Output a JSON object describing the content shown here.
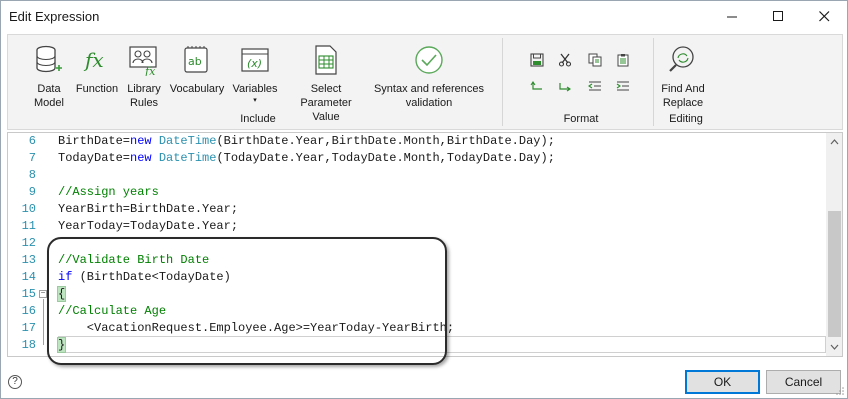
{
  "window": {
    "title": "Edit Expression"
  },
  "ribbon": {
    "include_items": [
      {
        "label": "Data\nModel",
        "icon": "database-icon"
      },
      {
        "label": "Function",
        "icon": "function-fx-icon"
      },
      {
        "label": "Library\nRules",
        "icon": "library-rules-icon"
      },
      {
        "label": "Vocabulary",
        "icon": "vocabulary-ab-icon"
      },
      {
        "label": "Variables",
        "icon": "variables-x-icon",
        "arrow": "▾"
      },
      {
        "label": "Select Parameter\nValue",
        "icon": "parameter-table-icon"
      },
      {
        "label": "Syntax and references\nvalidation",
        "icon": "validation-check-icon"
      }
    ],
    "include_group_label": "Include",
    "format_group_label": "Format",
    "format_buttons": [
      "save-icon",
      "cut-icon",
      "copy-icon",
      "paste-icon",
      "undo-icon",
      "redo-icon",
      "outdent-icon",
      "indent-icon"
    ],
    "editing_item": {
      "label": "Find And\nReplace",
      "icon": "find-replace-icon"
    },
    "editing_group_label": "Editing"
  },
  "editor": {
    "lines": [
      {
        "num": "6",
        "tokens": [
          [
            "",
            "BirthDate="
          ],
          [
            "kw",
            "new"
          ],
          [
            "",
            " "
          ],
          [
            "ty",
            "DateTime"
          ],
          [
            "",
            "(BirthDate.Year,BirthDate.Month,BirthDate.Day);"
          ]
        ]
      },
      {
        "num": "7",
        "tokens": [
          [
            "",
            "TodayDate="
          ],
          [
            "kw",
            "new"
          ],
          [
            "",
            " "
          ],
          [
            "ty",
            "DateTime"
          ],
          [
            "",
            "(TodayDate.Year,TodayDate.Month,TodayDate.Day);"
          ]
        ]
      },
      {
        "num": "8",
        "tokens": []
      },
      {
        "num": "9",
        "tokens": [
          [
            "cm",
            "//Assign years"
          ]
        ]
      },
      {
        "num": "10",
        "tokens": [
          [
            "",
            "YearBirth=BirthDate.Year;"
          ]
        ]
      },
      {
        "num": "11",
        "tokens": [
          [
            "",
            "YearToday=TodayDate.Year;"
          ]
        ]
      },
      {
        "num": "12",
        "tokens": []
      },
      {
        "num": "13",
        "tokens": [
          [
            "cm",
            "//Validate Birth Date"
          ]
        ]
      },
      {
        "num": "14",
        "tokens": [
          [
            "kw",
            "if"
          ],
          [
            "",
            " (BirthDate<TodayDate)"
          ]
        ]
      },
      {
        "num": "15",
        "tokens": [
          [
            "brace",
            "{"
          ]
        ]
      },
      {
        "num": "16",
        "tokens": [
          [
            "cm",
            "//Calculate Age"
          ]
        ]
      },
      {
        "num": "17",
        "tokens": [
          [
            "",
            "    <VacationRequest.Employee.Age>=YearToday-YearBirth;"
          ]
        ]
      },
      {
        "num": "18",
        "tokens": [
          [
            "brace",
            "}"
          ]
        ]
      }
    ]
  },
  "footer": {
    "help": "?",
    "ok_label": "OK",
    "cancel_label": "Cancel"
  },
  "colors": {
    "keyword": "#0000ff",
    "comment": "#008000",
    "type": "#2b91af",
    "line_number": "#2b91af",
    "ok_border": "#0078d7"
  }
}
